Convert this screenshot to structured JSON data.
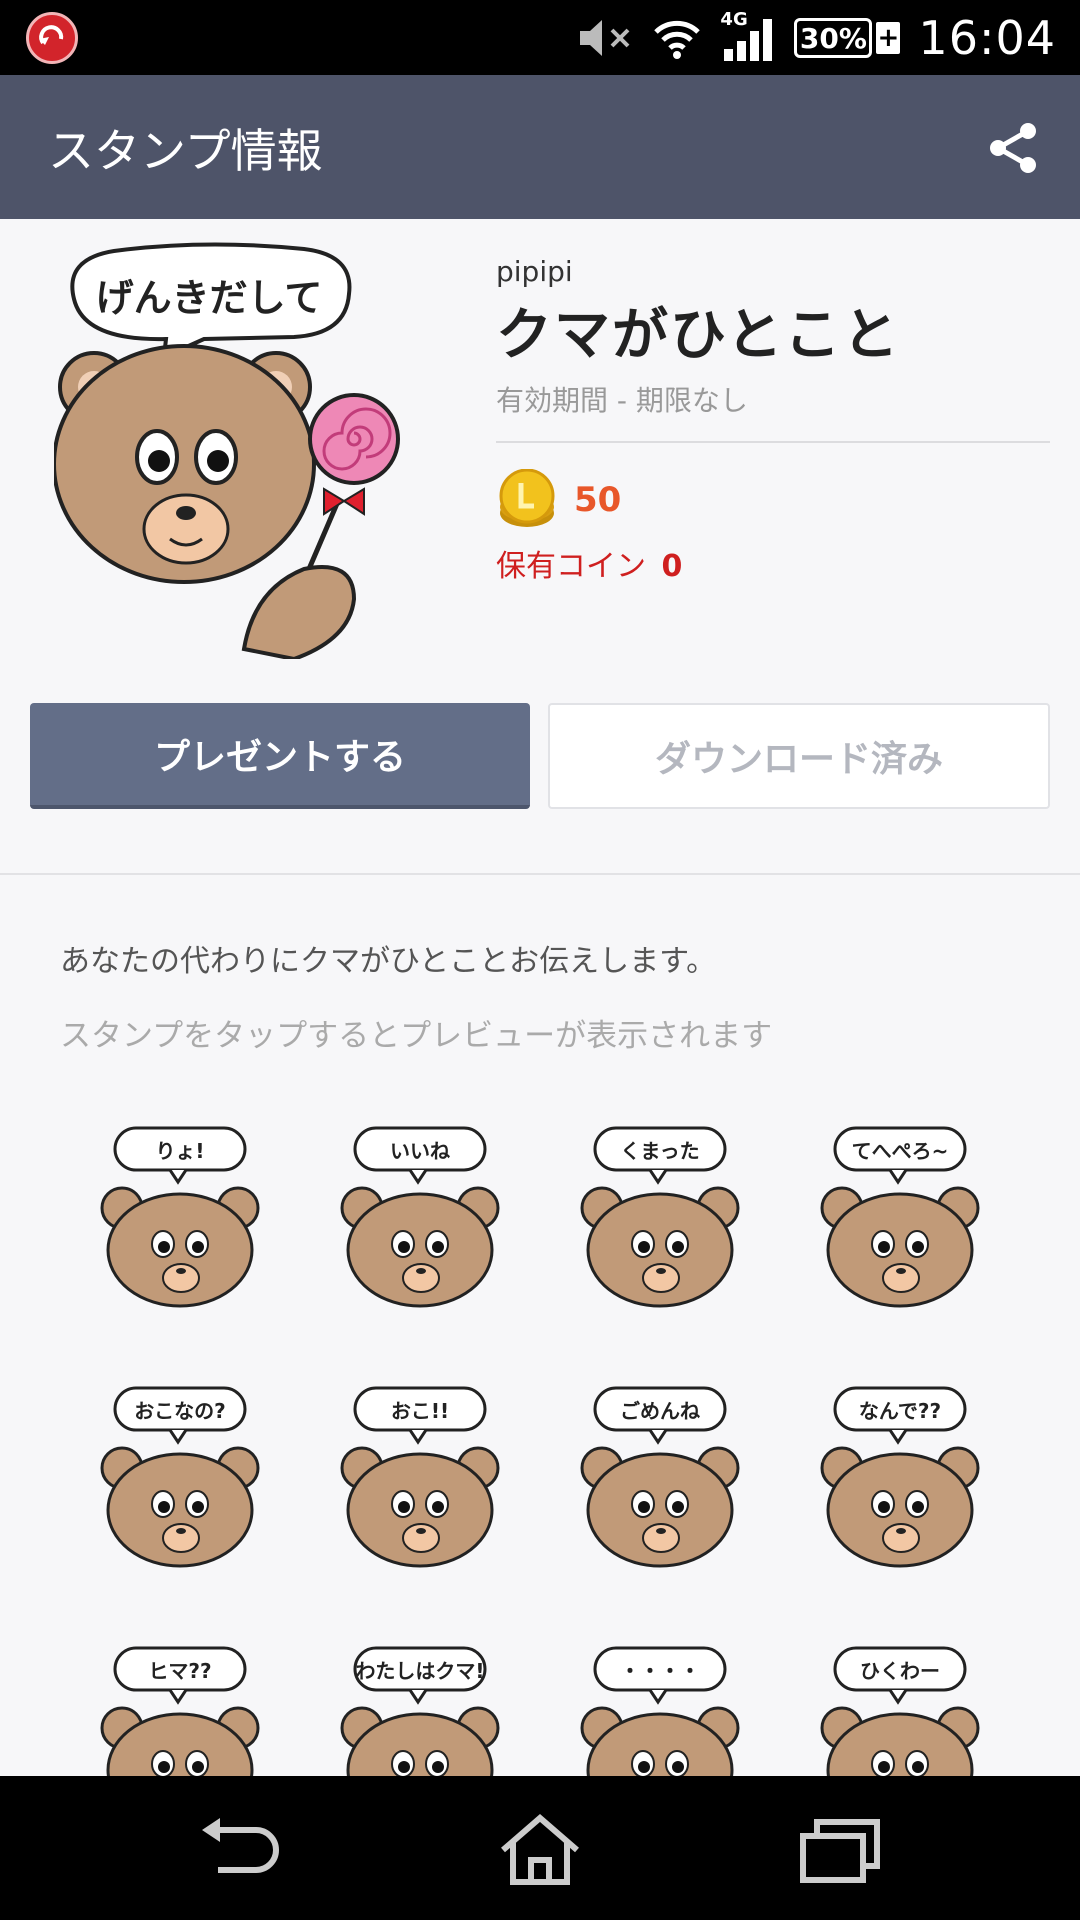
{
  "status_bar": {
    "network": "4G",
    "battery": "30%",
    "battery_charging": "+",
    "time": "16:04",
    "icons": [
      "app-logo-icon",
      "mute-icon",
      "wifi-icon",
      "signal-icon",
      "battery-icon"
    ]
  },
  "app_bar": {
    "title": "スタンプ情報",
    "share_icon": "share-icon"
  },
  "sticker": {
    "author": "pipipi",
    "title": "クマがひとこと",
    "validity": "有効期間 - 期限なし",
    "price": "50",
    "owned_label": "保有コイン",
    "owned_value": "0",
    "main_bubble_text": "げんきだして"
  },
  "buttons": {
    "gift": "プレゼントする",
    "download": "ダウンロード済み"
  },
  "description": "あなたの代わりにクマがひとことお伝えします。",
  "preview_hint": "スタンプをタップするとプレビューが表示されます",
  "stickers": [
    {
      "bubble": "りょ!"
    },
    {
      "bubble": "いいね"
    },
    {
      "bubble": "くまった"
    },
    {
      "bubble": "てへぺろ~"
    },
    {
      "bubble": "おこなの?"
    },
    {
      "bubble": "おこ!!"
    },
    {
      "bubble": "ごめんね"
    },
    {
      "bubble": "なんで??"
    },
    {
      "bubble": "ヒマ??"
    },
    {
      "bubble": "わたしはクマ!"
    },
    {
      "bubble": "・・・・"
    },
    {
      "bubble": "ひくわー"
    }
  ],
  "colors": {
    "app_bar": "#4e5469",
    "gift_button": "#636e88",
    "price": "#e8572a",
    "owned": "#cf1f1f",
    "bear": "#c19a78"
  },
  "nav_bar": {
    "icons": [
      "back-icon",
      "home-icon",
      "recent-apps-icon"
    ]
  }
}
